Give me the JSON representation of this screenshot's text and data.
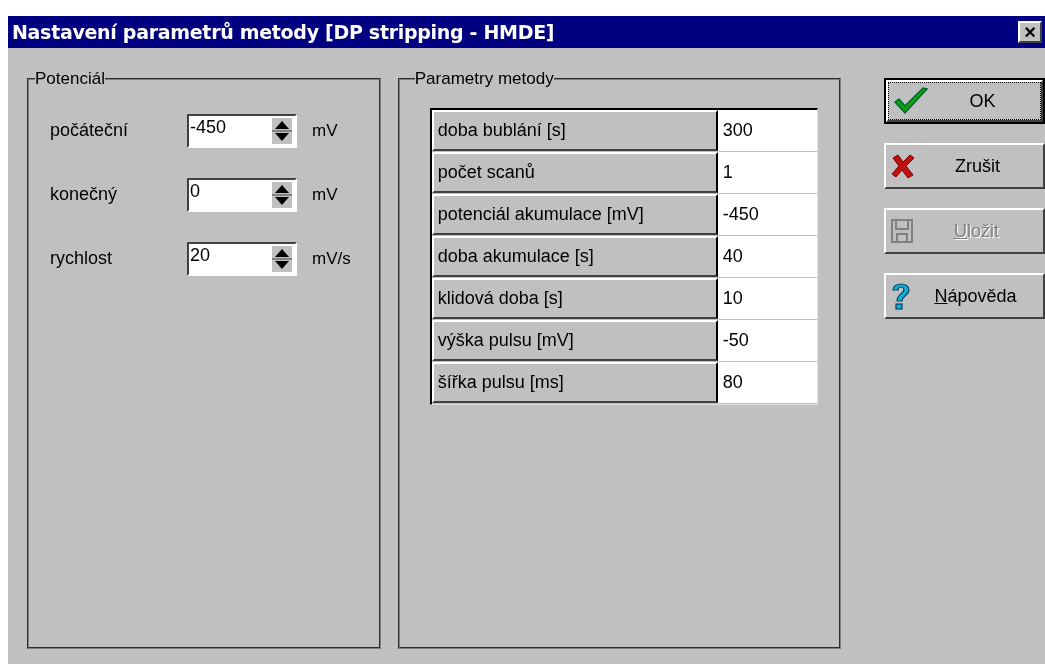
{
  "window": {
    "title": "Nastavení parametrů metody [DP stripping - HMDE]",
    "close_button": "×"
  },
  "potential_group": {
    "title": "Potenciál",
    "fields": [
      {
        "label": "počáteční",
        "value": "-450",
        "unit": "mV"
      },
      {
        "label": "konečný",
        "value": "0",
        "unit": "mV"
      },
      {
        "label": "rychlost",
        "value": "20",
        "unit": "mV/s"
      }
    ]
  },
  "method_group": {
    "title": "Parametry metody",
    "rows": [
      {
        "name": "doba bublání [s]",
        "value": "300"
      },
      {
        "name": "počet scanů",
        "value": "1"
      },
      {
        "name": "potenciál akumulace [mV]",
        "value": "-450"
      },
      {
        "name": "doba akumulace [s]",
        "value": "40"
      },
      {
        "name": "klidová doba [s]",
        "value": "10"
      },
      {
        "name": "výška pulsu [mV]",
        "value": "-50"
      },
      {
        "name": "šířka pulsu [ms]",
        "value": "80"
      }
    ]
  },
  "buttons": [
    {
      "label": "OK",
      "kind": "check",
      "default": true,
      "disabled": false,
      "mnemonic": false
    },
    {
      "label": "Zrušit",
      "kind": "cross",
      "default": false,
      "disabled": false,
      "mnemonic": false
    },
    {
      "label": "Uložit",
      "kind": "save",
      "default": false,
      "disabled": true,
      "mnemonic": true
    },
    {
      "label": "Nápověda",
      "kind": "help",
      "default": false,
      "disabled": false,
      "mnemonic": true
    }
  ]
}
